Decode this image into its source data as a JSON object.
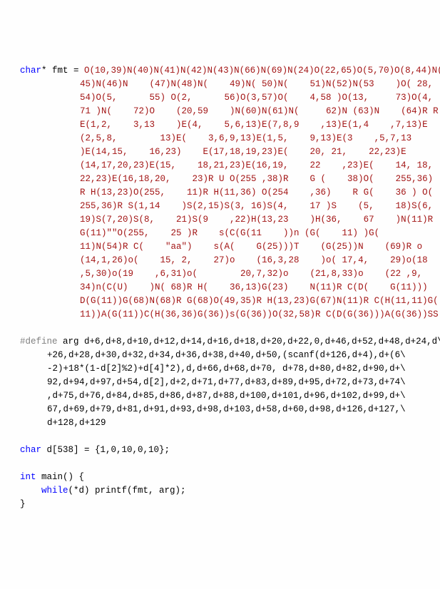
{
  "code": {
    "fmt_decl": [
      {
        "cls": "type",
        "text": "char"
      },
      {
        "cls": "id",
        "text": "* fmt = "
      },
      {
        "cls": "str",
        "text": "O(10,39)N(40)N(41)N(42)N(43)N(66)N(69)N(24)O(22,65)O(5,70)O(8,44)N("
      }
    ],
    "fmt_lines": [
      "45)N(46)N    (47)N(48)N(    49)N( 50)N(    51)N(52)N(53    )O( 28,",
      "54)O(5,      55) O(2,      56)O(3,57)O(    4,58 )O(13,     73)O(4,",
      "71 )N(    72)O    (20,59    )N(60)N(61)N(     62)N (63)N    (64)R R",
      "E(1,2,    3,13    )E(4,    5,6,13)E(7,8,9    ,13)E(1,4    ,7,13)E",
      "(2,5,8,        13)E(    3,6,9,13)E(1,5,    9,13)E(3    ,5,7,13",
      ")E(14,15,    16,23)    E(17,18,19,23)E(    20, 21,    22,23)E",
      "(14,17,20,23)E(15,    18,21,23)E(16,19,    22    ,23)E(    14, 18,",
      "22,23)E(16,18,20,    23)R U O(255 ,38)R    G (    38)O(    255,36)",
      "R H(13,23)O(255,    11)R H(11,36) O(254    ,36)    R G(    36 ) O(",
      "255,36)R S(1,14    )S(2,15)S(3, 16)S(4,    17 )S    (5,    18)S(6,",
      "19)S(7,20)S(8,    21)S(9    ,22)H(13,23    )H(36,    67    )N(11)R",
      "G(11)\"\"O(255,    25 )R    s(C(G(11    ))n (G(    11) )G(",
      "11)N(54)R C(    \"aa\")    s(A(    G(25)))T    (G(25))N    (69)R o",
      "(14,1,26)o(    15, 2,    27)o    (16,3,28    )o( 17,4,    29)o(18",
      ",5,30)o(19    ,6,31)o(        20,7,32)o    (21,8,33)o    (22 ,9,",
      "34)n(C(U)    )N( 68)R H(    36,13)G(23)    N(11)R C(D(    G(11)))",
      "D(G(11))G(68)N(68)R G(68)O(49,35)R H(13,23)G(67)N(11)R C(H(11,11)G(",
      "11))A(G(11))C(H(36,36)G(36))s(G(36))O(32,58)R C(D(G(36)))A(G(36))SS"
    ],
    "blank1": "",
    "define_decl": [
      {
        "cls": "macro",
        "text": "#define"
      },
      {
        "cls": "id",
        "text": " arg d+6,d+8,d+10,d+12,d+14,d+16,d+18,d+20,d+22,0,d+46,d+52,d+48,d+24,d\\"
      }
    ],
    "define_lines": [
      "+26,d+28,d+30,d+32,d+34,d+36,d+38,d+40,d+50,(scanf(d+126,d+4),d+(6\\",
      "-2)+18*(1-d[2]%2)+d[4]*2),d,d+66,d+68,d+70, d+78,d+80,d+82,d+90,d+\\",
      "92,d+94,d+97,d+54,d[2],d+2,d+71,d+77,d+83,d+89,d+95,d+72,d+73,d+74\\",
      ",d+75,d+76,d+84,d+85,d+86,d+87,d+88,d+100,d+101,d+96,d+102,d+99,d+\\",
      "67,d+69,d+79,d+81,d+91,d+93,d+98,d+103,d+58,d+60,d+98,d+126,d+127,\\",
      "d+128,d+129"
    ],
    "blank2": "",
    "arr_decl": [
      {
        "cls": "type",
        "text": "char"
      },
      {
        "cls": "id",
        "text": " d[538] = {1,0,10,0,10};"
      }
    ],
    "blank3": "",
    "main1": [
      {
        "cls": "type",
        "text": "int"
      },
      {
        "cls": "id",
        "text": " main() {"
      }
    ],
    "main2": [
      {
        "cls": "id",
        "text": "    "
      },
      {
        "cls": "type",
        "text": "while"
      },
      {
        "cls": "id",
        "text": "(*d) printf(fmt, arg);"
      }
    ],
    "main3": [
      {
        "cls": "id",
        "text": "}"
      }
    ]
  }
}
